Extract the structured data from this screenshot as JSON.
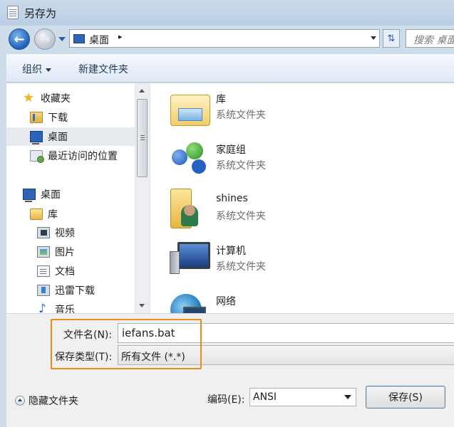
{
  "window": {
    "title": "另存为"
  },
  "address": {
    "location": "桌面",
    "separator": "▸"
  },
  "search": {
    "placeholder": "搜索 桌面"
  },
  "toolbar": {
    "organize_label": "组织",
    "new_folder_label": "新建文件夹"
  },
  "sidebar": {
    "favorites": [
      {
        "label": "收藏夹",
        "icon": "star-icon"
      },
      {
        "label": "下载",
        "icon": "download-folder-icon"
      },
      {
        "label": "桌面",
        "icon": "desktop-icon",
        "selected": true
      },
      {
        "label": "最近访问的位置",
        "icon": "recent-places-icon"
      }
    ],
    "desktop": {
      "label": "桌面",
      "icon": "desktop-icon"
    },
    "libraries": [
      {
        "label": "库",
        "icon": "library-icon"
      },
      {
        "label": "视频",
        "icon": "video-library-icon"
      },
      {
        "label": "图片",
        "icon": "pictures-library-icon"
      },
      {
        "label": "文档",
        "icon": "documents-library-icon"
      },
      {
        "label": "迅雷下载",
        "icon": "xunlei-download-icon"
      },
      {
        "label": "音乐",
        "icon": "music-library-icon"
      }
    ]
  },
  "files": [
    {
      "name": "库",
      "type": "系统文件夹",
      "icon": "library-folder-icon"
    },
    {
      "name": "家庭组",
      "type": "系统文件夹",
      "icon": "homegroup-icon"
    },
    {
      "name": "shines",
      "type": "系统文件夹",
      "icon": "user-folder-icon"
    },
    {
      "name": "计算机",
      "type": "系统文件夹",
      "icon": "computer-icon"
    },
    {
      "name": "网络",
      "type": "",
      "icon": "network-icon"
    }
  ],
  "form": {
    "filename_label": "文件名(N):",
    "filename_value": "iefans.bat",
    "filetype_label": "保存类型(T):",
    "filetype_value": "所有文件  (*.*)",
    "hide_folders_label": "隐藏文件夹",
    "encoding_label": "编码(E):",
    "encoding_value": "ANSI",
    "save_label": "保存(S)"
  },
  "colors": {
    "highlight_border": "#f28a1a",
    "accent": "#1f5fb7"
  }
}
